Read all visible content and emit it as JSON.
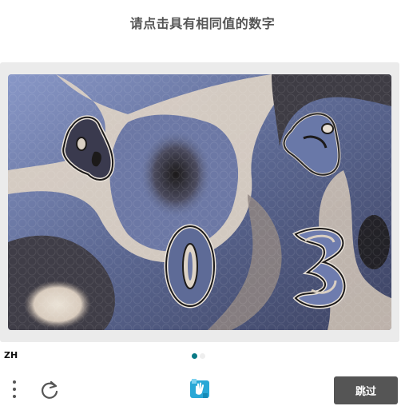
{
  "prompt": {
    "title": "请点击具有相同值的数字"
  },
  "challenge": {
    "digits": [
      "4",
      "6",
      "0",
      "3"
    ]
  },
  "footer": {
    "language": "ZH",
    "pages": 2,
    "current_page": 1,
    "skip_label": "跳过"
  },
  "icons": {
    "menu": "more-vertical-icon",
    "refresh": "refresh-icon",
    "logo": "hand-logo-icon"
  },
  "colors": {
    "panel_bg": "#ebebeb",
    "button_bg": "#555555",
    "active_dot": "#0a7a86",
    "image_blue": "#6a7aa8",
    "image_cream": "#e6ddd2",
    "image_dark": "#2c2a2a"
  }
}
